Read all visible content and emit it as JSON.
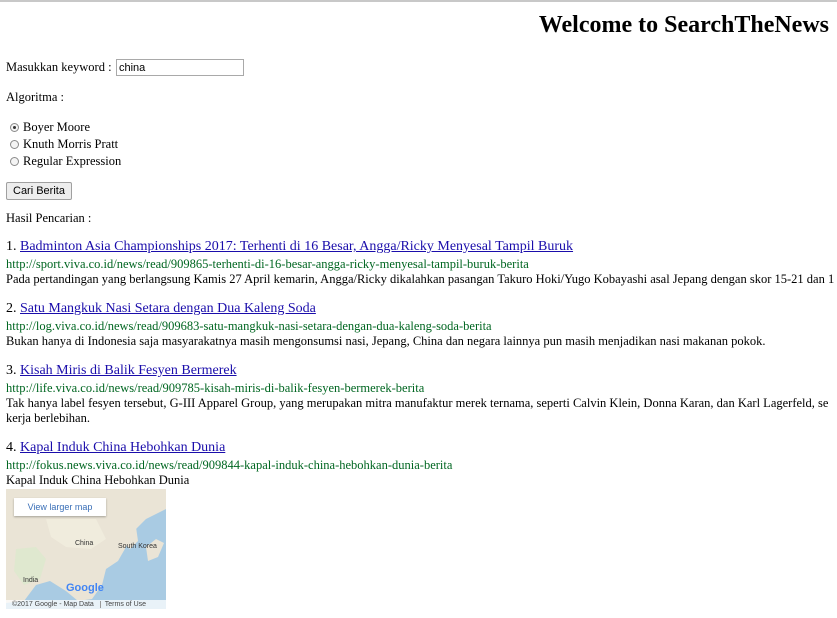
{
  "header": {
    "title": "Welcome to SearchTheNews"
  },
  "form": {
    "keyword_label": "Masukkan keyword :",
    "keyword_value": "china",
    "algorithm_label": "Algoritma :",
    "algorithms": [
      {
        "label": "Boyer Moore",
        "checked": true
      },
      {
        "label": "Knuth Morris Pratt",
        "checked": false
      },
      {
        "label": "Regular Expression",
        "checked": false
      }
    ],
    "submit_label": "Cari Berita"
  },
  "results_label": "Hasil Pencarian :",
  "results": [
    {
      "number": "1.",
      "title": "Badminton Asia Championships 2017: Terhenti di 16 Besar, Angga/Ricky Menyesal Tampil Buruk",
      "url": "http://sport.viva.co.id/news/read/909865-terhenti-di-16-besar-angga-ricky-menyesal-tampil-buruk-berita",
      "description": "Pada pertandingan yang berlangsung Kamis 27 April kemarin, Angga/Ricky dikalahkan pasangan Takuro Hoki/Yugo Kobayashi asal Jepang dengan skor 15-21 dan 1"
    },
    {
      "number": "2.",
      "title": "Satu Mangkuk Nasi Setara dengan Dua Kaleng Soda",
      "url": "http://log.viva.co.id/news/read/909683-satu-mangkuk-nasi-setara-dengan-dua-kaleng-soda-berita",
      "description": "Bukan hanya di Indonesia saja masyarakatnya masih mengonsumsi nasi, Jepang, China dan negara lainnya pun masih menjadikan nasi makanan pokok."
    },
    {
      "number": "3.",
      "title": "Kisah Miris di Balik Fesyen Bermerek",
      "url": "http://life.viva.co.id/news/read/909785-kisah-miris-di-balik-fesyen-bermerek-berita",
      "description": "Tak hanya label fesyen tersebut, G-III Apparel Group, yang merupakan mitra manufaktur merek ternama, seperti Calvin Klein, Donna Karan, dan Karl Lagerfeld, se",
      "description_line2": "kerja berlebihan."
    },
    {
      "number": "4.",
      "title": "Kapal Induk China Hebohkan Dunia",
      "url": "http://fokus.news.viva.co.id/news/read/909844-kapal-induk-china-hebohkan-dunia-berita",
      "description": "Kapal Induk China Hebohkan Dunia"
    }
  ],
  "map": {
    "larger_map_label": "View larger map",
    "labels": {
      "china": "China",
      "south_korea": "South Korea",
      "india": "India"
    },
    "google_logo": "Google",
    "attribution": "©2017 Google - Map Data",
    "terms": "Terms of Use"
  }
}
